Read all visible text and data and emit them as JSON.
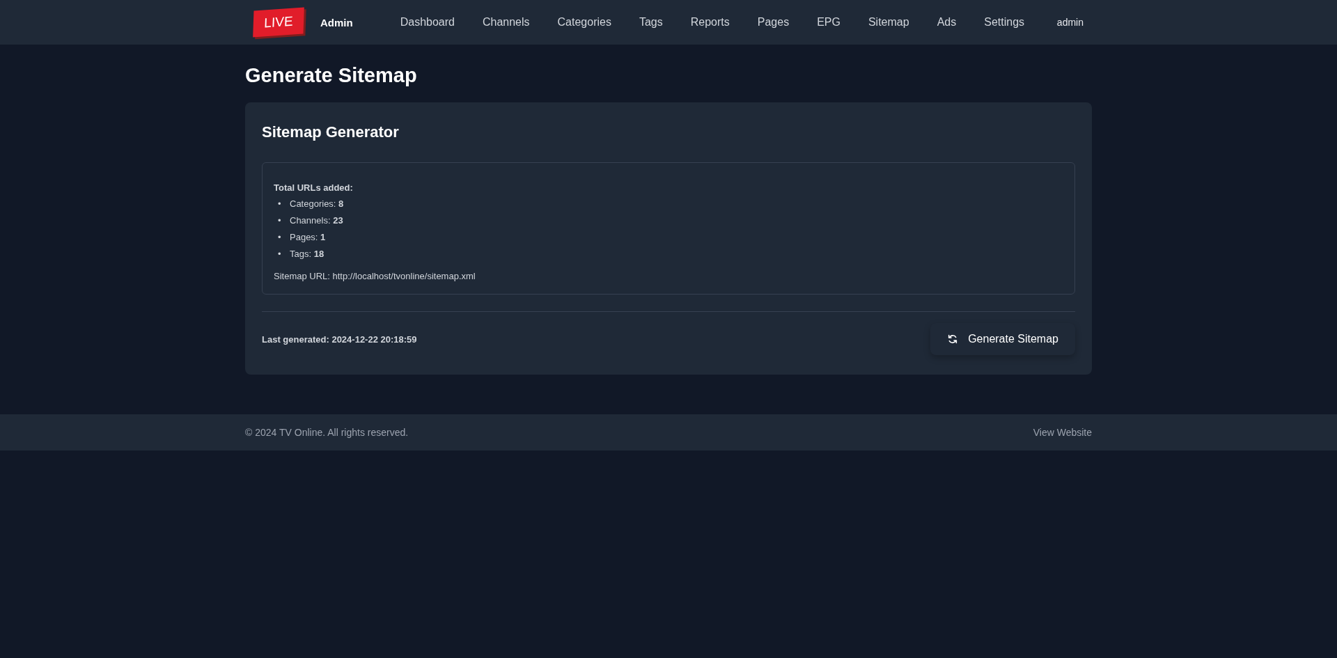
{
  "header": {
    "logo": "LIVE",
    "brand": "Admin",
    "nav": [
      {
        "label": "Dashboard"
      },
      {
        "label": "Channels"
      },
      {
        "label": "Categories"
      },
      {
        "label": "Tags"
      },
      {
        "label": "Reports"
      },
      {
        "label": "Pages"
      },
      {
        "label": "EPG"
      },
      {
        "label": "Sitemap"
      },
      {
        "label": "Ads"
      },
      {
        "label": "Settings"
      }
    ],
    "user": "admin"
  },
  "page_title": "Generate Sitemap",
  "card": {
    "title": "Sitemap Generator",
    "result": {
      "heading": "Total URLs added:",
      "items": [
        {
          "bullet": "•",
          "text": "Categories: **8**"
        },
        {
          "bullet": "•",
          "text": "Channels: **23**"
        },
        {
          "bullet": "•",
          "text": "Pages: **1**"
        },
        {
          "bullet": "•",
          "text": "Tags: **18**"
        }
      ],
      "sitemap_url": "Sitemap URL: http://localhost/tvonline/sitemap.xml"
    },
    "last_generated": "Last generated: 2024-12-22 20:18:59",
    "button": "Generate Sitemap"
  },
  "footer": {
    "copyright": "© 2024 TV Online. All rights reserved.",
    "link": "View Website"
  }
}
